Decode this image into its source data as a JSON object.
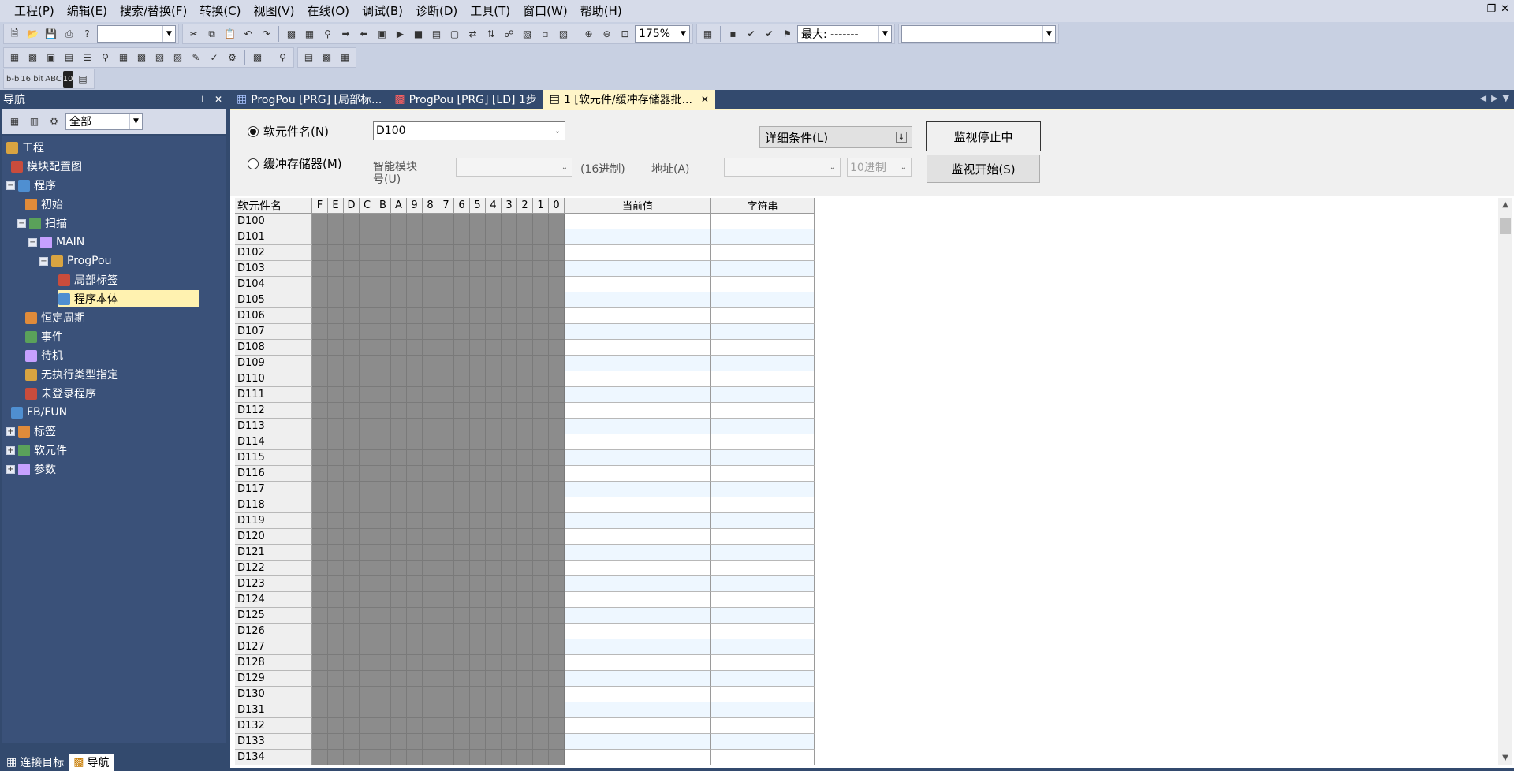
{
  "menu": [
    "工程(P)",
    "编辑(E)",
    "搜索/替换(F)",
    "转换(C)",
    "视图(V)",
    "在线(O)",
    "调试(B)",
    "诊断(D)",
    "工具(T)",
    "窗口(W)",
    "帮助(H)"
  ],
  "toolbar": {
    "zoom": "175%",
    "max_label": "最大: -------"
  },
  "toolbar3_labels": [
    "b-b",
    "16 bit",
    "ABC",
    "10"
  ],
  "nav": {
    "title": "导航",
    "filter": "全部",
    "tree": [
      {
        "label": "工程",
        "level": 0,
        "exp": ""
      },
      {
        "label": "模块配置图",
        "level": 1,
        "exp": ""
      },
      {
        "label": "程序",
        "level": 0,
        "exp": "−"
      },
      {
        "label": "初始",
        "level": 2,
        "exp": ""
      },
      {
        "label": "扫描",
        "level": 1,
        "exp": "−"
      },
      {
        "label": "MAIN",
        "level": 2,
        "exp": "−"
      },
      {
        "label": "ProgPou",
        "level": 3,
        "exp": "−"
      },
      {
        "label": "局部标签",
        "level": 5,
        "exp": ""
      },
      {
        "label": "程序本体",
        "level": 5,
        "exp": "",
        "selected": true
      },
      {
        "label": "恒定周期",
        "level": 2,
        "exp": ""
      },
      {
        "label": "事件",
        "level": 2,
        "exp": ""
      },
      {
        "label": "待机",
        "level": 2,
        "exp": ""
      },
      {
        "label": "无执行类型指定",
        "level": 2,
        "exp": ""
      },
      {
        "label": "未登录程序",
        "level": 2,
        "exp": ""
      },
      {
        "label": "FB/FUN",
        "level": 1,
        "exp": ""
      },
      {
        "label": "标签",
        "level": 0,
        "exp": "+"
      },
      {
        "label": "软元件",
        "level": 0,
        "exp": "+"
      },
      {
        "label": "参数",
        "level": 0,
        "exp": "+"
      }
    ],
    "footer_tabs": [
      "连接目标",
      "导航"
    ]
  },
  "tabs": [
    {
      "label": "ProgPou [PRG] [局部标..."
    },
    {
      "label": "ProgPou [PRG] [LD] 1步"
    },
    {
      "label": "1 [软元件/缓冲存储器批..."
    }
  ],
  "monitor": {
    "device_radio": "软元件名(N)",
    "device_value": "D100",
    "buffer_radio": "缓冲存储器(M)",
    "module_label_1": "智能模块",
    "module_label_2": "号(U)",
    "hex16": "(16进制)",
    "address_label": "地址(A)",
    "radix": "10进制",
    "detail": "详细条件(L)",
    "stop_btn": "监视停止中",
    "start_btn": "监视开始(S)"
  },
  "grid": {
    "headers": {
      "name": "软元件名",
      "value": "当前值",
      "string": "字符串"
    },
    "bits": [
      "F",
      "E",
      "D",
      "C",
      "B",
      "A",
      "9",
      "8",
      "7",
      "6",
      "5",
      "4",
      "3",
      "2",
      "1",
      "0"
    ],
    "rows": [
      "D100",
      "D101",
      "D102",
      "D103",
      "D104",
      "D105",
      "D106",
      "D107",
      "D108",
      "D109",
      "D110",
      "D111",
      "D112",
      "D113",
      "D114",
      "D115",
      "D116",
      "D117",
      "D118",
      "D119",
      "D120",
      "D121",
      "D122",
      "D123",
      "D124",
      "D125",
      "D126",
      "D127",
      "D128",
      "D129",
      "D130",
      "D131",
      "D132",
      "D133",
      "D134"
    ]
  },
  "colors": {
    "nav_bg": "#3a5179",
    "active_tab": "#fff5c8",
    "bit_cell": "#8c8c8c",
    "selected_item": "#fff2b0"
  }
}
